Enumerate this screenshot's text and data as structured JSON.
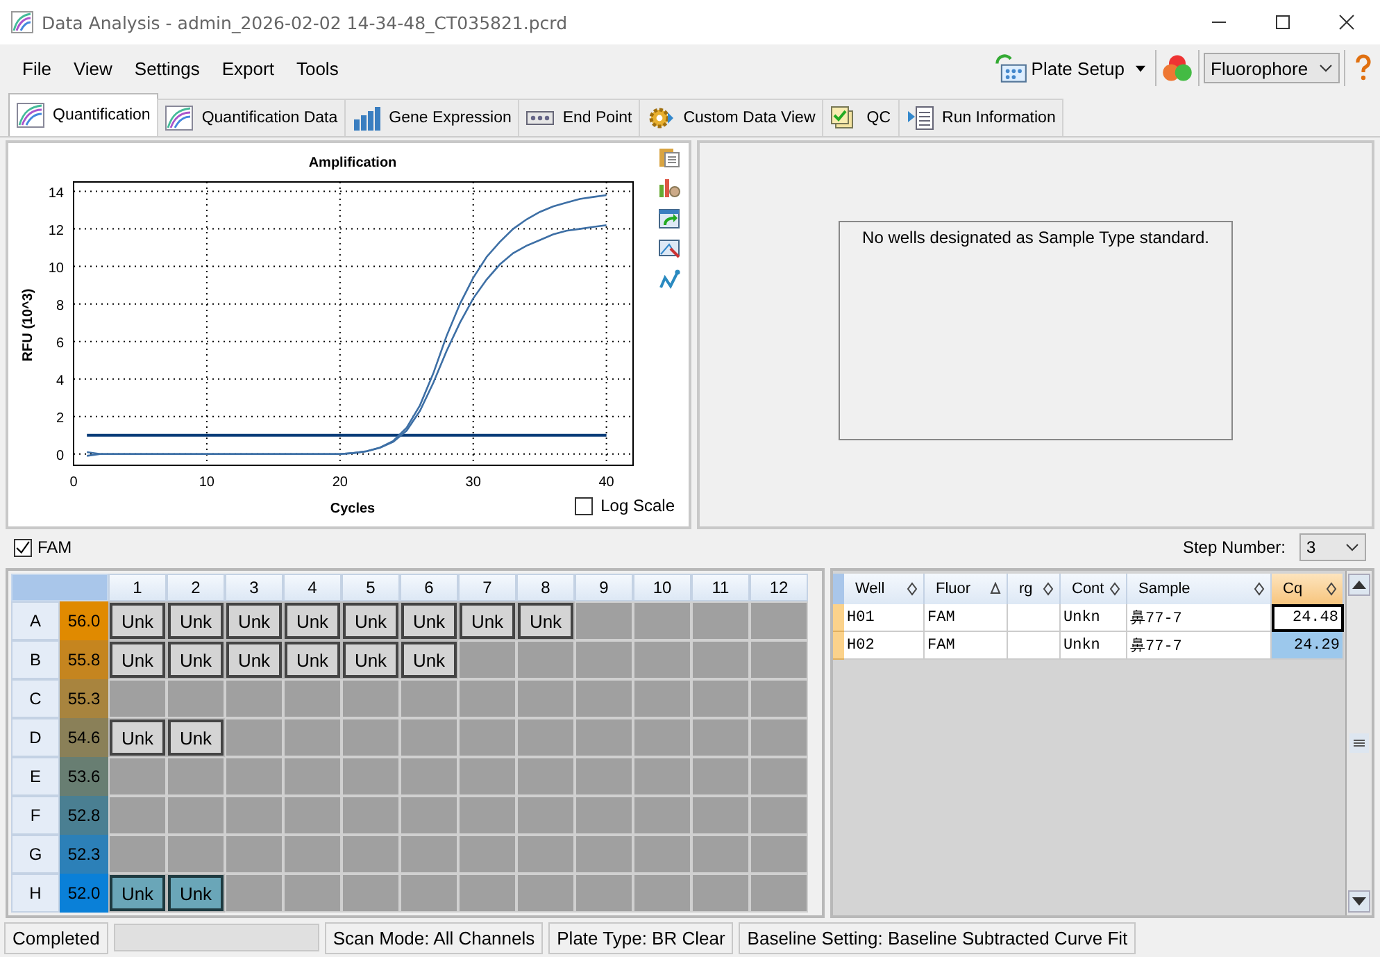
{
  "window": {
    "title": "Data Analysis - admin_2026-02-02 14-34-48_CT035821.pcrd"
  },
  "menu": [
    "File",
    "View",
    "Settings",
    "Export",
    "Tools"
  ],
  "toolbar": {
    "plate_setup": "Plate Setup",
    "view_select": "Fluorophore"
  },
  "tabs": [
    {
      "label": "Quantification",
      "selected": true
    },
    {
      "label": "Quantification Data",
      "selected": false
    },
    {
      "label": "Gene Expression",
      "selected": false
    },
    {
      "label": "End Point",
      "selected": false
    },
    {
      "label": "Custom Data View",
      "selected": false
    },
    {
      "label": "QC",
      "selected": false
    },
    {
      "label": "Run Information",
      "selected": false
    }
  ],
  "chart": {
    "chart_data": {
      "type": "line",
      "title": "Amplification",
      "xlabel": "Cycles",
      "ylabel": "RFU (10^3)",
      "x": [
        1,
        2,
        3,
        4,
        5,
        6,
        7,
        8,
        9,
        10,
        11,
        12,
        13,
        14,
        15,
        16,
        17,
        18,
        19,
        20,
        21,
        22,
        23,
        24,
        25,
        26,
        27,
        28,
        29,
        30,
        31,
        32,
        33,
        34,
        35,
        36,
        37,
        38,
        39,
        40
      ],
      "series": [
        {
          "color": "#3d6fa5",
          "values": [
            -0.1,
            0,
            0,
            0,
            0,
            0,
            0,
            0,
            0,
            0,
            0,
            0,
            0,
            0,
            0,
            0,
            0,
            0,
            0,
            0,
            0.05,
            0.15,
            0.35,
            0.7,
            1.4,
            2.6,
            4.3,
            6.3,
            8.0,
            9.4,
            10.5,
            11.3,
            12.0,
            12.5,
            12.9,
            13.2,
            13.4,
            13.6,
            13.7,
            13.8
          ]
        },
        {
          "color": "#3d6fa5",
          "values": [
            0.1,
            0,
            0,
            0,
            0,
            0,
            0,
            0,
            0,
            0,
            0,
            0,
            0,
            0,
            0,
            0,
            0,
            0,
            0,
            0,
            0.05,
            0.15,
            0.33,
            0.65,
            1.25,
            2.3,
            3.8,
            5.5,
            7.0,
            8.3,
            9.3,
            10.1,
            10.7,
            11.1,
            11.4,
            11.7,
            11.9,
            12.0,
            12.1,
            12.2
          ]
        }
      ],
      "xlim": [
        0,
        42
      ],
      "ylim": [
        -0.6,
        14.5
      ],
      "xticks": [
        0,
        10,
        20,
        30,
        40
      ],
      "yticks": [
        0,
        2,
        4,
        6,
        8,
        10,
        12,
        14
      ],
      "grid": true,
      "ref_lines": [
        {
          "axis": "y",
          "value": 1,
          "color": "#0a3c78"
        }
      ]
    },
    "log_scale": {
      "label": "Log Scale",
      "checked": false
    }
  },
  "standard_curve": {
    "message": "No wells designated as Sample Type standard."
  },
  "fluor_filter": {
    "label": "FAM",
    "checked": true
  },
  "step": {
    "label": "Step Number:",
    "value": "3"
  },
  "plate": {
    "columns": [
      "1",
      "2",
      "3",
      "4",
      "5",
      "6",
      "7",
      "8",
      "9",
      "10",
      "11",
      "12"
    ],
    "rows": [
      {
        "label": "A",
        "temp": "56.0",
        "color": "#e08a00",
        "wells": [
          {
            "text": "Unk",
            "selected": false
          },
          {
            "text": "Unk",
            "selected": false
          },
          {
            "text": "Unk",
            "selected": false
          },
          {
            "text": "Unk",
            "selected": false
          },
          {
            "text": "Unk",
            "selected": false
          },
          {
            "text": "Unk",
            "selected": false
          },
          {
            "text": "Unk",
            "selected": false
          },
          {
            "text": "Unk",
            "selected": false
          }
        ]
      },
      {
        "label": "B",
        "temp": "55.8",
        "color": "#c5851f",
        "wells": [
          {
            "text": "Unk",
            "selected": false
          },
          {
            "text": "Unk",
            "selected": false
          },
          {
            "text": "Unk",
            "selected": false
          },
          {
            "text": "Unk",
            "selected": false
          },
          {
            "text": "Unk",
            "selected": false
          },
          {
            "text": "Unk",
            "selected": false
          }
        ]
      },
      {
        "label": "C",
        "temp": "55.3",
        "color": "#a8843e",
        "wells": []
      },
      {
        "label": "D",
        "temp": "54.6",
        "color": "#8a8058",
        "wells": [
          {
            "text": "Unk",
            "selected": false
          },
          {
            "text": "Unk",
            "selected": false
          }
        ]
      },
      {
        "label": "E",
        "temp": "53.6",
        "color": "#687e72",
        "wells": []
      },
      {
        "label": "F",
        "temp": "52.8",
        "color": "#4a7f92",
        "wells": []
      },
      {
        "label": "G",
        "temp": "52.3",
        "color": "#2c80b8",
        "wells": []
      },
      {
        "label": "H",
        "temp": "52.0",
        "color": "#0a80d8",
        "wells": [
          {
            "text": "Unk",
            "selected": true
          },
          {
            "text": "Unk",
            "selected": true
          }
        ]
      }
    ]
  },
  "results": {
    "columns": [
      {
        "label": "Well",
        "sorted": false,
        "selected": false
      },
      {
        "label": "Fluor",
        "sorted": true,
        "selected": false
      },
      {
        "label": "rg",
        "sorted": false,
        "selected": false
      },
      {
        "label": "Cont",
        "sorted": false,
        "selected": false
      },
      {
        "label": "Sample",
        "sorted": false,
        "selected": false
      },
      {
        "label": "Cq",
        "sorted": false,
        "selected": true
      }
    ],
    "rows": [
      {
        "cells": [
          "H01",
          "FAM",
          "",
          "Unkn",
          "鼻77-7",
          "24.48"
        ],
        "focused": true,
        "selected": false
      },
      {
        "cells": [
          "H02",
          "FAM",
          "",
          "Unkn",
          "鼻77-7",
          "24.29"
        ],
        "focused": false,
        "selected": true
      }
    ]
  },
  "status_bar": [
    "Completed",
    "Scan Mode: All Channels",
    "Plate Type: BR Clear",
    "Baseline Setting: Baseline Subtracted Curve Fit"
  ]
}
